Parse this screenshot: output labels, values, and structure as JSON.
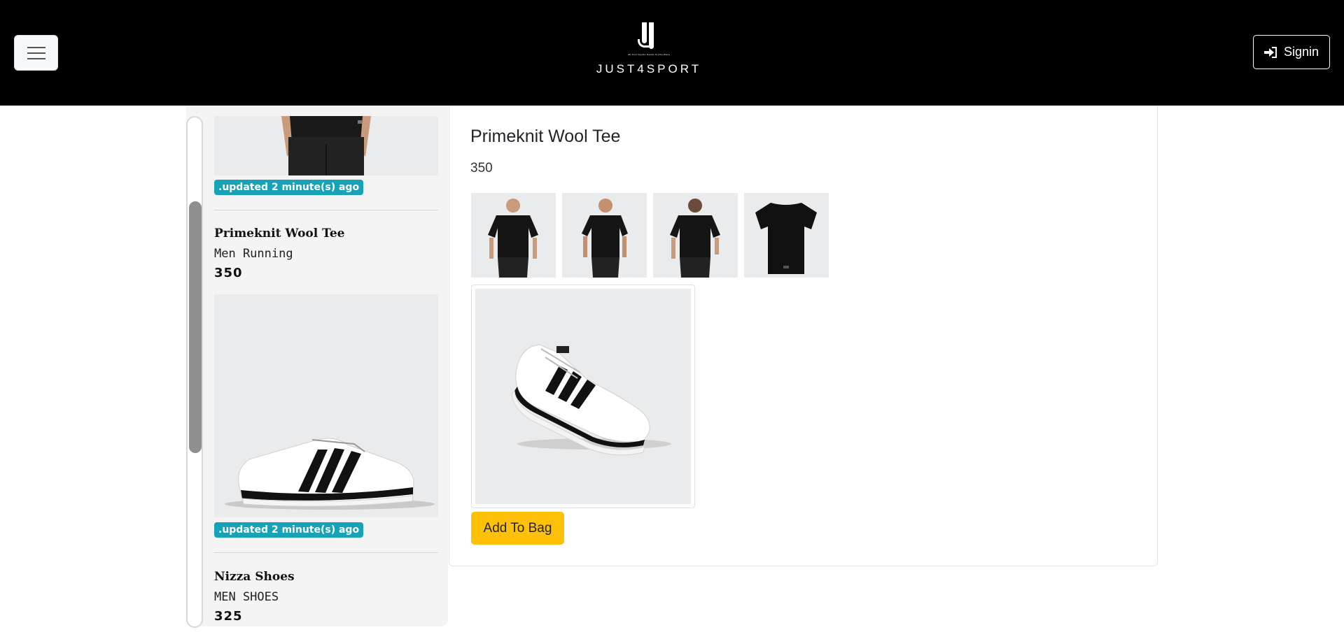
{
  "header": {
    "brand_name": "JUST4SPORT",
    "brand_tagline": "All Your Sports Needs In One Place",
    "signin_label": "Signin"
  },
  "list": {
    "items": [
      {
        "badge": ".updated 2 minute(s) ago"
      },
      {
        "name": "Primeknit Wool Tee",
        "category": "Men Running",
        "price": "350",
        "badge": ".updated 2 minute(s) ago"
      },
      {
        "name": "Nizza Shoes",
        "category": "MEN SHOES",
        "price": "325"
      }
    ]
  },
  "detail": {
    "title": "Primeknit Wool Tee",
    "price": "350",
    "thumbnails": [
      "tee-front",
      "tee-model-front",
      "tee-back",
      "tee-flat"
    ],
    "add_to_bag_label": "Add To Bag"
  },
  "colors": {
    "header_bg": "#000000",
    "badge_bg": "#17a2b8",
    "add_to_bag_bg": "#ffc107"
  }
}
